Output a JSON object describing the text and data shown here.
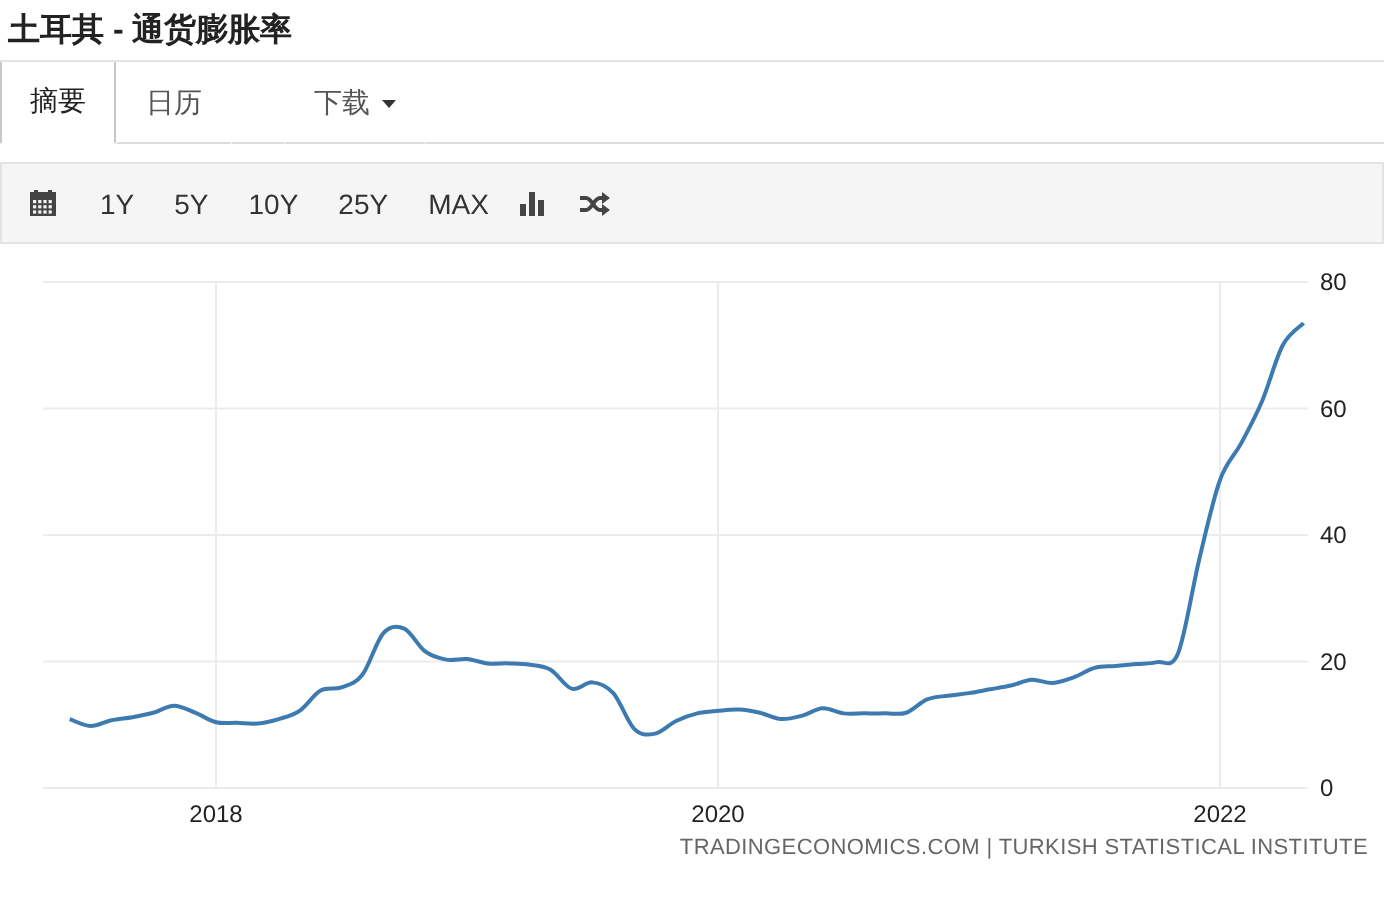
{
  "title": "土耳其 - 通货膨胀率",
  "tabs": [
    {
      "label": "摘要",
      "selected": true,
      "dropdown": false
    },
    {
      "label": "日历",
      "selected": false,
      "dropdown": false
    },
    {
      "label": "下载",
      "selected": false,
      "dropdown": true
    }
  ],
  "toolbar": [
    {
      "kind": "calendar"
    },
    {
      "kind": "range",
      "label": "1Y"
    },
    {
      "kind": "range",
      "label": "5Y"
    },
    {
      "kind": "range",
      "label": "10Y"
    },
    {
      "kind": "range",
      "label": "25Y"
    },
    {
      "kind": "range",
      "label": "MAX"
    },
    {
      "kind": "bars"
    },
    {
      "kind": "shuffle"
    }
  ],
  "chart": {
    "chart_data": {
      "type": "line",
      "grid": true,
      "xlim": [
        2017.31,
        2022.35
      ],
      "ylim": [
        0,
        80
      ],
      "xticks": [
        2018,
        2020,
        2022
      ],
      "yticks": [
        0,
        20,
        40,
        60,
        80
      ],
      "x": [
        2017.417,
        2017.5,
        2017.583,
        2017.667,
        2017.75,
        2017.833,
        2017.917,
        2018,
        2018.083,
        2018.167,
        2018.25,
        2018.333,
        2018.417,
        2018.5,
        2018.583,
        2018.667,
        2018.75,
        2018.833,
        2018.917,
        2019,
        2019.083,
        2019.167,
        2019.25,
        2019.333,
        2019.417,
        2019.5,
        2019.583,
        2019.667,
        2019.75,
        2019.833,
        2019.917,
        2020,
        2020.083,
        2020.167,
        2020.25,
        2020.333,
        2020.417,
        2020.5,
        2020.583,
        2020.667,
        2020.75,
        2020.833,
        2020.917,
        2021,
        2021.083,
        2021.167,
        2021.25,
        2021.333,
        2021.417,
        2021.5,
        2021.583,
        2021.667,
        2021.75,
        2021.833,
        2021.917,
        2022,
        2022.083,
        2022.167,
        2022.25,
        2022.333
      ],
      "series": [
        {
          "color": "#3d7ab0",
          "values": [
            10.9,
            9.8,
            10.7,
            11.2,
            11.9,
            13,
            11.9,
            10.4,
            10.3,
            10.2,
            10.9,
            12.2,
            15.4,
            15.9,
            17.9,
            24.5,
            25.2,
            21.6,
            20.3,
            20.4,
            19.7,
            19.7,
            19.5,
            18.7,
            15.7,
            16.7,
            15,
            9.3,
            8.6,
            10.6,
            11.8,
            12.2,
            12.4,
            11.9,
            10.9,
            11.4,
            12.6,
            11.8,
            11.8,
            11.8,
            11.9,
            14,
            14.6,
            15,
            15.6,
            16.2,
            17.1,
            16.6,
            17.5,
            19,
            19.3,
            19.6,
            19.9,
            21.3,
            36.1,
            48.7,
            54.4,
            61.1,
            70,
            73.5
          ]
        }
      ]
    },
    "source": "TRADINGECONOMICS.COM | TURKISH STATISTICAL INSTITUTE"
  }
}
